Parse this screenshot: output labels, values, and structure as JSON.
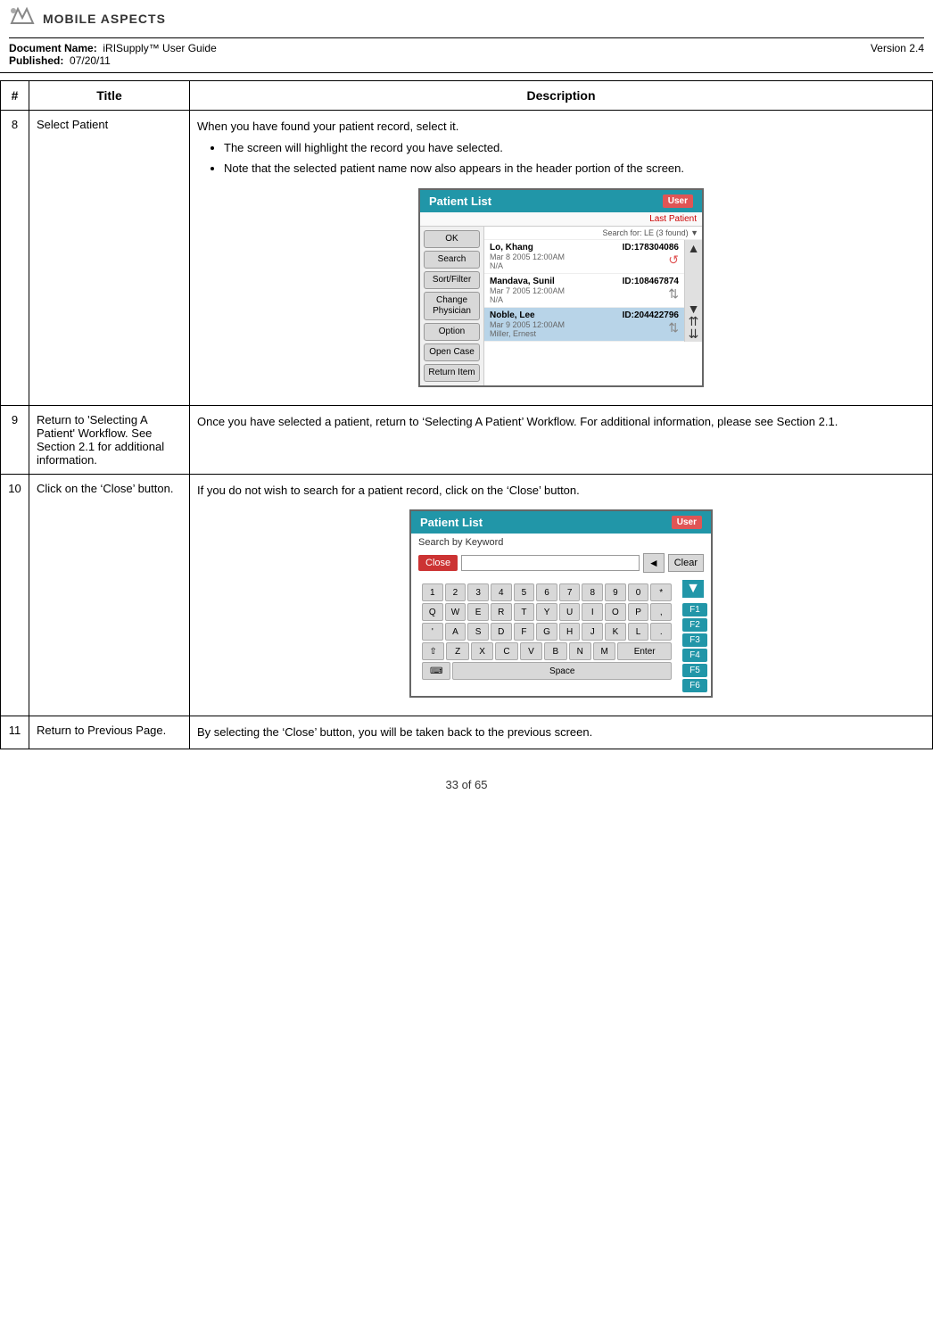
{
  "header": {
    "logo_text": "MOBILE ASPECTS",
    "doc_name_label": "Document Name:",
    "doc_name": "iRISupply™ User Guide",
    "published_label": "Published:",
    "published_date": "07/20/11",
    "version": "Version 2.4"
  },
  "table": {
    "col_num": "#",
    "col_title": "Title",
    "col_desc": "Description",
    "rows": [
      {
        "num": "8",
        "title": "Select Patient",
        "desc_intro": "When you have found your patient record, select it.",
        "bullets": [
          "The screen will highlight the record you have selected.",
          "Note that the selected patient name now also appears in the header portion of the screen."
        ],
        "has_patient_list": true,
        "has_keyboard": false
      },
      {
        "num": "9",
        "title": "Return to 'Selecting A Patient' Workflow.  See Section 2.1 for additional information.",
        "desc_intro": "Once you have selected a patient, return to ‘Selecting A Patient’ Workflow.  For additional information, please see Section 2.1.",
        "bullets": [],
        "has_patient_list": false,
        "has_keyboard": false
      },
      {
        "num": "10",
        "title": "Click on the ‘Close’ button.",
        "desc_intro": "If you do not wish to search for a patient record, click on the ‘Close’ button.",
        "bullets": [],
        "has_patient_list": false,
        "has_keyboard": true
      },
      {
        "num": "11",
        "title": "Return to Previous Page.",
        "desc_intro": "By selecting the ‘Close’ button, you will be taken back to the previous screen.",
        "bullets": [],
        "has_patient_list": false,
        "has_keyboard": false
      }
    ]
  },
  "patient_list": {
    "title": "Patient List",
    "user_label": "User",
    "last_patient_label": "Last Patient",
    "search_info": "Search for: LE (3 found) ▼",
    "patients": [
      {
        "name": "Lo, Khang",
        "id": "ID:178304086",
        "date": "Mar 8 2005 12:00AM",
        "note": "N/A",
        "selected": false
      },
      {
        "name": "Mandava, Sunil",
        "id": "ID:108467874",
        "date": "Mar 7 2005 12:00AM",
        "note": "N/A",
        "selected": false
      },
      {
        "name": "Noble, Lee",
        "id": "ID:204422796",
        "date": "Mar 9 2005 12:00AM",
        "note": "Miller, Ernest",
        "selected": true
      }
    ],
    "buttons": [
      "OK",
      "Search",
      "Sort/Filter",
      "Change Physician",
      "Option",
      "Open Case",
      "Return Item"
    ]
  },
  "keyboard": {
    "title": "Patient List",
    "user_label": "User",
    "search_label": "Search by Keyword",
    "close_btn": "Close",
    "clear_btn": "Clear",
    "arrow_btn": "◄",
    "row1": [
      "1",
      "2",
      "3",
      "4",
      "5",
      "6",
      "7",
      "8",
      "9",
      "0",
      "*"
    ],
    "row2": [
      "Q",
      "W",
      "E",
      "R",
      "T",
      "Y",
      "U",
      "I",
      "O",
      "P",
      ","
    ],
    "row3": [
      "'",
      "A",
      "S",
      "D",
      "F",
      "G",
      "H",
      "J",
      "K",
      "L",
      "."
    ],
    "row4_left": [
      "⇧",
      "Z",
      "X",
      "C",
      "V",
      "B",
      "N",
      "M"
    ],
    "enter_label": "Enter",
    "shift_label": "⇧",
    "keyboard_icon": "⌨",
    "space_label": "Space",
    "f_buttons": [
      "F1",
      "F2",
      "F3",
      "F4",
      "F5",
      "F6"
    ]
  },
  "footer": {
    "page_text": "33 of 65"
  }
}
